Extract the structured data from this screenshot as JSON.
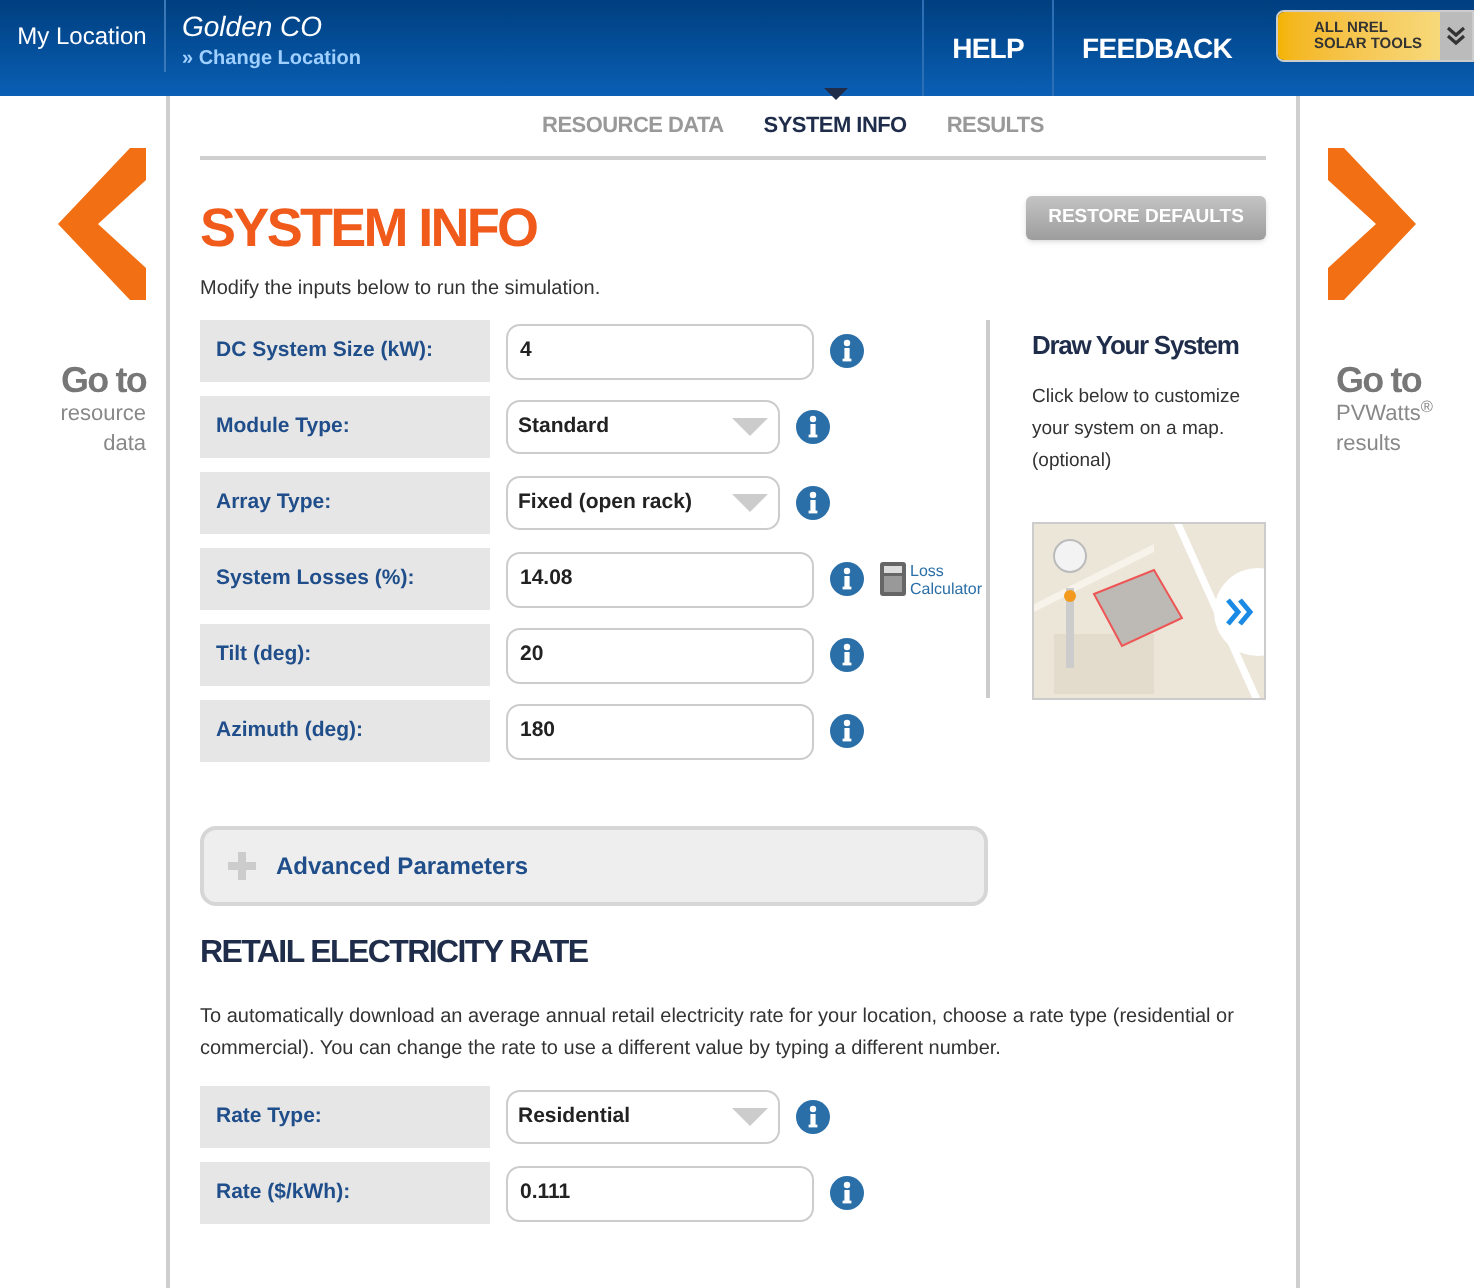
{
  "header": {
    "location_label": "My Location",
    "location_name": "Golden CO",
    "change_link": "» Change Location",
    "nav": [
      "HELP",
      "FEEDBACK"
    ],
    "tools_button": [
      "ALL NREL",
      "SOLAR TOOLS"
    ]
  },
  "tabs": [
    {
      "label": "RESOURCE DATA",
      "selected": false
    },
    {
      "label": "SYSTEM INFO",
      "selected": true
    },
    {
      "label": "RESULTS",
      "selected": false
    }
  ],
  "prev": {
    "title": "Go to",
    "lines": [
      "resource",
      "data"
    ]
  },
  "next": {
    "title": "Go to",
    "lines": [
      "PVWatts$^{®}$",
      "results"
    ]
  },
  "title": "SYSTEM INFO",
  "restore_button": "RESTORE DEFAULTS",
  "intro": "Modify the inputs below to run the simulation.",
  "fields": [
    {
      "label": "DC System Size (kW):",
      "kind": "text",
      "value": "4"
    },
    {
      "label": "Module Type:",
      "kind": "select",
      "value": "Standard"
    },
    {
      "label": "Array Type:",
      "kind": "select",
      "value": "Fixed (open rack)"
    },
    {
      "label": "System Losses (%):",
      "kind": "text",
      "value": "14.08",
      "link": [
        "Loss",
        "Calculator"
      ]
    },
    {
      "label": "Tilt (deg):",
      "kind": "text",
      "value": "20"
    },
    {
      "label": "Azimuth (deg):",
      "kind": "text",
      "value": "180"
    }
  ],
  "draw": {
    "title": "Draw Your System",
    "text": "Click below to customize your system on a map. (optional)"
  },
  "advanced": {
    "label": "Advanced Parameters",
    "expanded": false
  },
  "rate_section": {
    "title": "RETAIL ELECTRICITY RATE",
    "text": "To automatically download an average annual retail electricity rate for your location, choose a rate type (residential or commercial). You can change the rate to use a different value by typing a different number.",
    "fields": [
      {
        "label": "Rate Type:",
        "kind": "select",
        "value": "Residential"
      },
      {
        "label": "Rate ($/kWh):",
        "kind": "text",
        "value": "0.111"
      }
    ]
  }
}
